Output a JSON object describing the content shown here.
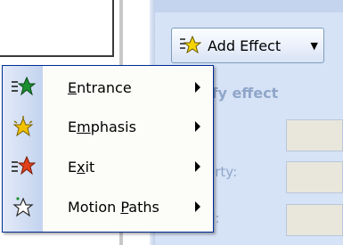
{
  "task_pane": {
    "add_effect_label": "Add Effect",
    "section_title": "ify effect",
    "properties": [
      {
        "label": ":"
      },
      {
        "label": "erty:"
      },
      {
        "label": "d:"
      }
    ]
  },
  "menu": {
    "items": [
      {
        "prefix": "",
        "access_key": "E",
        "suffix": "ntrance",
        "icon": "entrance-star-icon"
      },
      {
        "prefix": "E",
        "access_key": "m",
        "suffix": "phasis",
        "icon": "emphasis-star-icon"
      },
      {
        "prefix": "E",
        "access_key": "x",
        "suffix": "it",
        "icon": "exit-star-icon"
      },
      {
        "prefix": "Motion ",
        "access_key": "P",
        "suffix": "aths",
        "icon": "motion-path-star-icon"
      }
    ]
  },
  "colors": {
    "entrance_star": "#1a8f2e",
    "emphasis_star": "#f2c200",
    "exit_star": "#e0401a",
    "menu_border": "#002d96",
    "pane_background": "#d6e2f6"
  }
}
